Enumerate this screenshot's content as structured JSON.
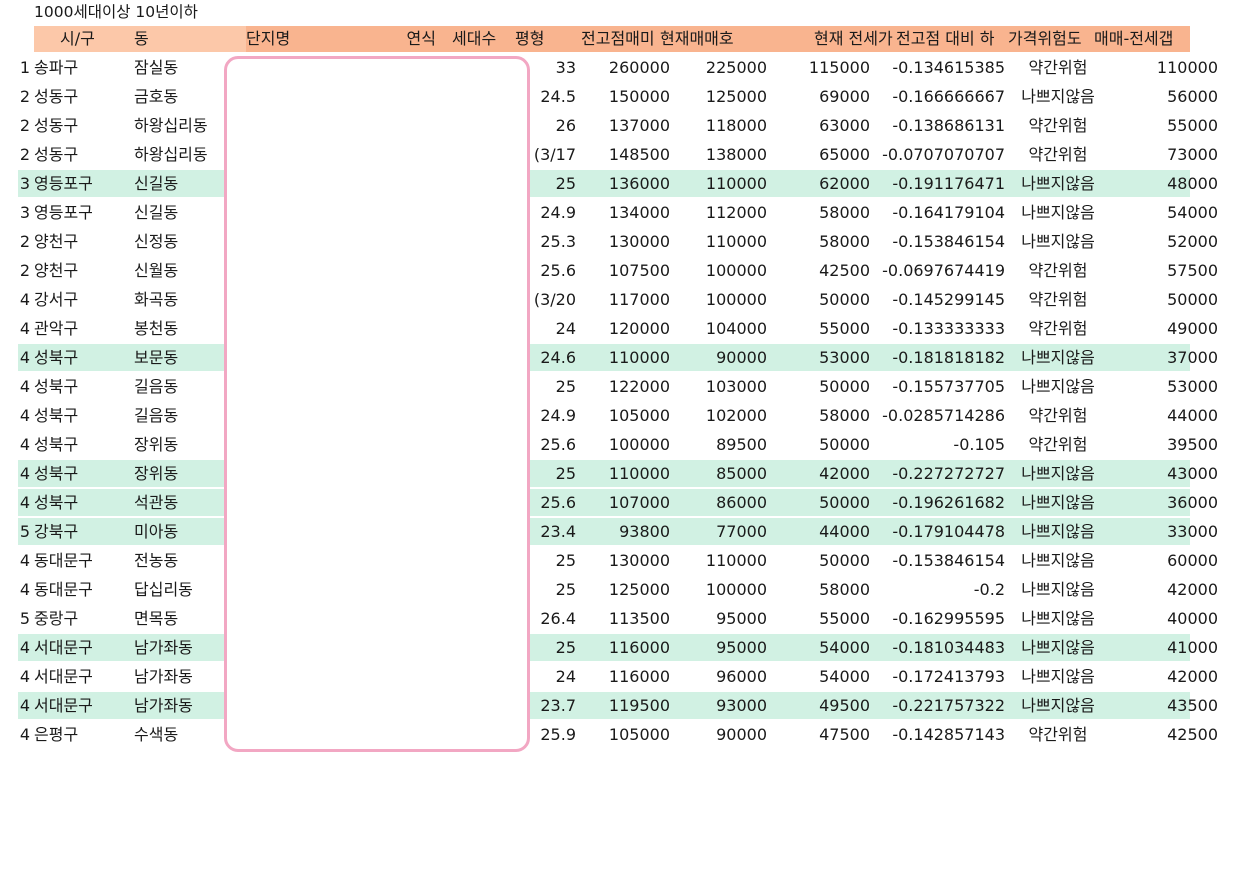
{
  "caption": "1000세대이상 10년이하",
  "colors": {
    "header_fill": "#fcc8a9",
    "header_fill_dark": "#f9b48f",
    "highlight_row": "#d1f1e3",
    "mask_border": "#f2a7c3"
  },
  "headers": [
    "시/구",
    "동",
    "단지명",
    "연식",
    "세대수",
    "평형",
    "전고점매매",
    "현재매매호가",
    "현재 전세가",
    "전고점 대비 하락률",
    "가격위험도",
    "매매-전세갭"
  ],
  "header_display": [
    "시/구",
    "동",
    "단지명",
    "연식",
    "세대수",
    "평형",
    "전고점매미",
    "현재매매호",
    "현재 전세가",
    "전고점 대비 하",
    "가격위험도",
    "매매-전세갭"
  ],
  "rows": [
    {
      "n": "1",
      "gu": "송파구",
      "dong": "잠실동",
      "size": "33",
      "peak": "260000",
      "ask": "225000",
      "jeonse": "115000",
      "drop": "-0.134615385",
      "risk": "약간위험",
      "gap": "110000",
      "hl": false
    },
    {
      "n": "2",
      "gu": "성동구",
      "dong": "금호동",
      "size": "24.5",
      "peak": "150000",
      "ask": "125000",
      "jeonse": "69000",
      "drop": "-0.166666667",
      "risk": "나쁘지않음",
      "gap": "56000",
      "hl": false
    },
    {
      "n": "2",
      "gu": "성동구",
      "dong": "하왕십리동",
      "size": "26",
      "peak": "137000",
      "ask": "118000",
      "jeonse": "63000",
      "drop": "-0.138686131",
      "risk": "약간위험",
      "gap": "55000",
      "hl": false
    },
    {
      "n": "2",
      "gu": "성동구",
      "dong": "하왕십리동",
      "size": "(3/17",
      "peak": "148500",
      "ask": "138000",
      "jeonse": "65000",
      "drop": "-0.0707070707",
      "risk": "약간위험",
      "gap": "73000",
      "hl": false
    },
    {
      "n": "3",
      "gu": "영등포구",
      "dong": "신길동",
      "size": "25",
      "peak": "136000",
      "ask": "110000",
      "jeonse": "62000",
      "drop": "-0.191176471",
      "risk": "나쁘지않음",
      "gap": "48000",
      "hl": true
    },
    {
      "n": "3",
      "gu": "영등포구",
      "dong": "신길동",
      "size": "24.9",
      "peak": "134000",
      "ask": "112000",
      "jeonse": "58000",
      "drop": "-0.164179104",
      "risk": "나쁘지않음",
      "gap": "54000",
      "hl": false
    },
    {
      "n": "2",
      "gu": "양천구",
      "dong": "신정동",
      "size": "25.3",
      "peak": "130000",
      "ask": "110000",
      "jeonse": "58000",
      "drop": "-0.153846154",
      "risk": "나쁘지않음",
      "gap": "52000",
      "hl": false
    },
    {
      "n": "2",
      "gu": "양천구",
      "dong": "신월동",
      "size": "25.6",
      "peak": "107500",
      "ask": "100000",
      "jeonse": "42500",
      "drop": "-0.0697674419",
      "risk": "약간위험",
      "gap": "57500",
      "hl": false
    },
    {
      "n": "4",
      "gu": "강서구",
      "dong": "화곡동",
      "size": "(3/20",
      "peak": "117000",
      "ask": "100000",
      "jeonse": "50000",
      "drop": "-0.145299145",
      "risk": "약간위험",
      "gap": "50000",
      "hl": false
    },
    {
      "n": "4",
      "gu": "관악구",
      "dong": "봉천동",
      "size": "24",
      "peak": "120000",
      "ask": "104000",
      "jeonse": "55000",
      "drop": "-0.133333333",
      "risk": "약간위험",
      "gap": "49000",
      "hl": false
    },
    {
      "n": "4",
      "gu": "성북구",
      "dong": "보문동",
      "size": "24.6",
      "peak": "110000",
      "ask": "90000",
      "jeonse": "53000",
      "drop": "-0.181818182",
      "risk": "나쁘지않음",
      "gap": "37000",
      "hl": true
    },
    {
      "n": "4",
      "gu": "성북구",
      "dong": "길음동",
      "size": "25",
      "peak": "122000",
      "ask": "103000",
      "jeonse": "50000",
      "drop": "-0.155737705",
      "risk": "나쁘지않음",
      "gap": "53000",
      "hl": false
    },
    {
      "n": "4",
      "gu": "성북구",
      "dong": "길음동",
      "size": "24.9",
      "peak": "105000",
      "ask": "102000",
      "jeonse": "58000",
      "drop": "-0.0285714286",
      "risk": "약간위험",
      "gap": "44000",
      "hl": false
    },
    {
      "n": "4",
      "gu": "성북구",
      "dong": "장위동",
      "size": "25.6",
      "peak": "100000",
      "ask": "89500",
      "jeonse": "50000",
      "drop": "-0.105",
      "risk": "약간위험",
      "gap": "39500",
      "hl": false
    },
    {
      "n": "4",
      "gu": "성북구",
      "dong": "장위동",
      "size": "25",
      "peak": "110000",
      "ask": "85000",
      "jeonse": "42000",
      "drop": "-0.227272727",
      "risk": "나쁘지않음",
      "gap": "43000",
      "hl": true
    },
    {
      "n": "4",
      "gu": "성북구",
      "dong": "석관동",
      "size": "25.6",
      "peak": "107000",
      "ask": "86000",
      "jeonse": "50000",
      "drop": "-0.196261682",
      "risk": "나쁘지않음",
      "gap": "36000",
      "hl": true
    },
    {
      "n": "5",
      "gu": "강북구",
      "dong": "미아동",
      "size": "23.4",
      "peak": "93800",
      "ask": "77000",
      "jeonse": "44000",
      "drop": "-0.179104478",
      "risk": "나쁘지않음",
      "gap": "33000",
      "hl": true
    },
    {
      "n": "4",
      "gu": "동대문구",
      "dong": "전농동",
      "size": "25",
      "peak": "130000",
      "ask": "110000",
      "jeonse": "50000",
      "drop": "-0.153846154",
      "risk": "나쁘지않음",
      "gap": "60000",
      "hl": false
    },
    {
      "n": "4",
      "gu": "동대문구",
      "dong": "답십리동",
      "size": "25",
      "peak": "125000",
      "ask": "100000",
      "jeonse": "58000",
      "drop": "-0.2",
      "risk": "나쁘지않음",
      "gap": "42000",
      "hl": false
    },
    {
      "n": "5",
      "gu": "중랑구",
      "dong": "면목동",
      "size": "26.4",
      "peak": "113500",
      "ask": "95000",
      "jeonse": "55000",
      "drop": "-0.162995595",
      "risk": "나쁘지않음",
      "gap": "40000",
      "hl": false
    },
    {
      "n": "4",
      "gu": "서대문구",
      "dong": "남가좌동",
      "size": "25",
      "peak": "116000",
      "ask": "95000",
      "jeonse": "54000",
      "drop": "-0.181034483",
      "risk": "나쁘지않음",
      "gap": "41000",
      "hl": true
    },
    {
      "n": "4",
      "gu": "서대문구",
      "dong": "남가좌동",
      "size": "24",
      "peak": "116000",
      "ask": "96000",
      "jeonse": "54000",
      "drop": "-0.172413793",
      "risk": "나쁘지않음",
      "gap": "42000",
      "hl": false
    },
    {
      "n": "4",
      "gu": "서대문구",
      "dong": "남가좌동",
      "size": "23.7",
      "peak": "119500",
      "ask": "93000",
      "jeonse": "49500",
      "drop": "-0.221757322",
      "risk": "나쁘지않음",
      "gap": "43500",
      "hl": true
    },
    {
      "n": "4",
      "gu": "은평구",
      "dong": "수색동",
      "size": "25.9",
      "peak": "105000",
      "ask": "90000",
      "jeonse": "47500",
      "drop": "-0.142857143",
      "risk": "약간위험",
      "gap": "42500",
      "hl": false
    }
  ]
}
